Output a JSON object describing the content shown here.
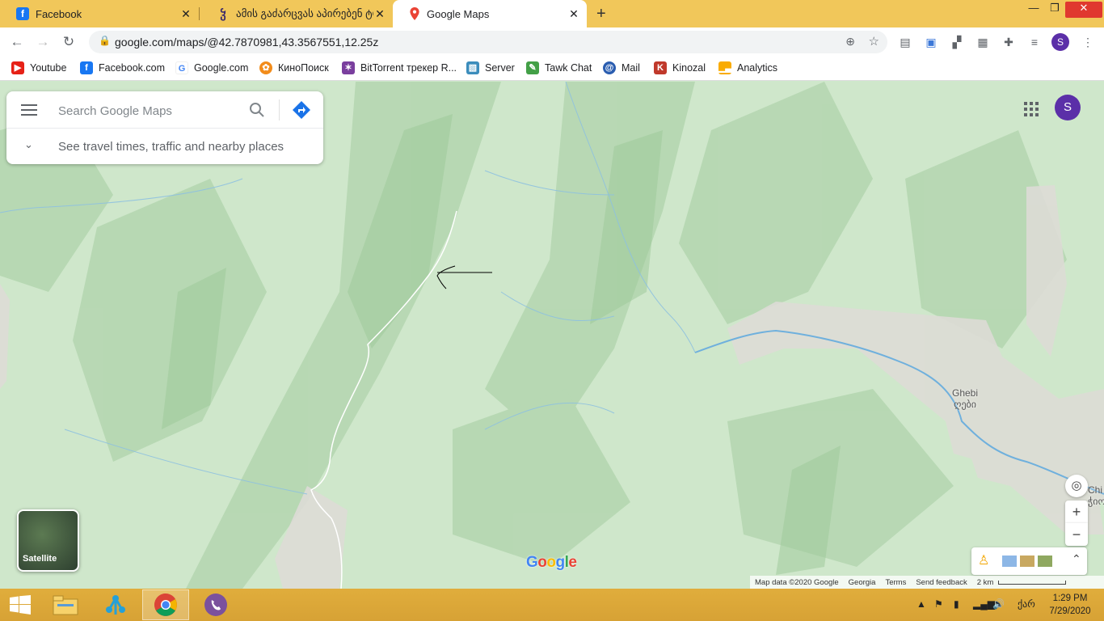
{
  "browser": {
    "tabs": [
      {
        "title": "Facebook",
        "icon": "facebook-icon",
        "active": false
      },
      {
        "title": "ამის გაძარცვას აპირებენ ტრ",
        "icon": "site-icon",
        "active": false
      },
      {
        "title": "Google Maps",
        "icon": "google-maps-icon",
        "active": true
      }
    ],
    "new_tab": "+",
    "url": "google.com/maps/@42.7870981,43.3567551,12.25z",
    "profile_initial": "S",
    "bookmarks": [
      {
        "label": "Youtube",
        "icon": "youtube-icon",
        "color": "#e62117"
      },
      {
        "label": "Facebook.com",
        "icon": "facebook-icon",
        "color": "#1877f2"
      },
      {
        "label": "Google.com",
        "icon": "google-icon",
        "color": "#4285f4"
      },
      {
        "label": "КиноПоиск",
        "icon": "kinopoisk-icon",
        "color": "#f28c1b"
      },
      {
        "label": "BitTorrent трекер R...",
        "icon": "bittorrent-icon",
        "color": "#7a3f9e"
      },
      {
        "label": "Server",
        "icon": "server-icon",
        "color": "#3c8dbc"
      },
      {
        "label": "Tawk Chat",
        "icon": "tawk-icon",
        "color": "#43a047"
      },
      {
        "label": "Mail",
        "icon": "mail-icon",
        "color": "#2a5db0"
      },
      {
        "label": "Kinozal",
        "icon": "kinozal-icon",
        "color": "#c0392b"
      },
      {
        "label": "Analytics",
        "icon": "analytics-icon",
        "color": "#f9ab00"
      }
    ]
  },
  "maps": {
    "search_placeholder": "Search Google Maps",
    "travel_text": "See travel times, traffic and nearby places",
    "account_initial": "S",
    "satellite_label": "Satellite",
    "logo": [
      "G",
      "o",
      "o",
      "g",
      "l",
      "e"
    ],
    "places": [
      {
        "name": "Ghebi",
        "local": "ღები"
      },
      {
        "name": "Chi",
        "local": "ჭიო"
      }
    ],
    "footer": {
      "map_data": "Map data ©2020 Google",
      "region": "Georgia",
      "terms": "Terms",
      "feedback": "Send feedback",
      "scale": "2 km"
    }
  },
  "taskbar": {
    "time": "1:29 PM",
    "date": "7/29/2020",
    "lang": "ქარ"
  },
  "colors": {
    "tabbar": "#f1c75a",
    "taskbar": "#d9a436",
    "map_green": "#cde6c9",
    "accent_purple": "#5b2fa8"
  }
}
